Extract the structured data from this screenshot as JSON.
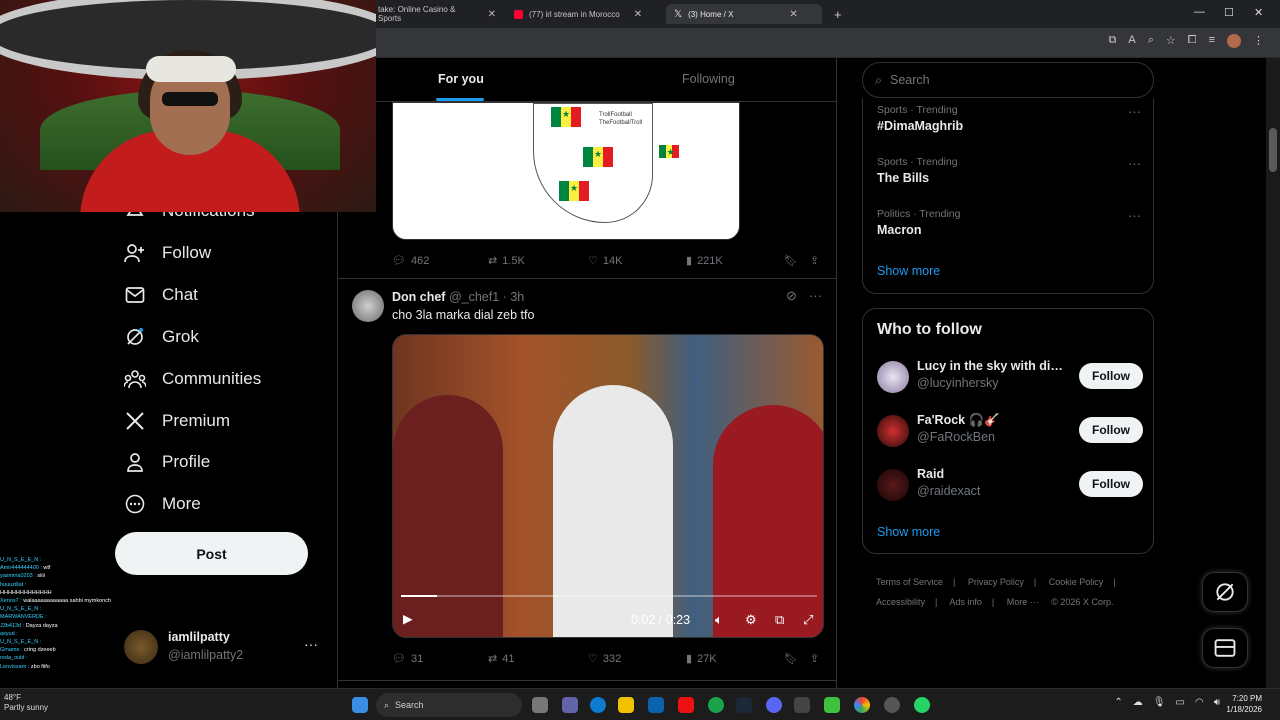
{
  "browser": {
    "tabs": [
      {
        "label": "take: Online Casino & Sports"
      },
      {
        "label": "(77) irl stream in Morocco"
      },
      {
        "label": "(3) Home / X"
      }
    ],
    "new_tab_label": "+"
  },
  "chat_overlay": {
    "messages": [
      {
        "user": "U_N_S_E_E_N :",
        "text": ""
      },
      {
        "user": "Amir444444400 :",
        "text": "wtf"
      },
      {
        "user": "yasmina0203 :",
        "text": "siiii"
      },
      {
        "user": "huuuzillat :",
        "text": ""
      },
      {
        "user": "",
        "text": "HHHHHHHHHHHHH"
      },
      {
        "user": "Xenos7 :",
        "text": "walaaaaaaaaaaaa sahbi mymkonch"
      },
      {
        "user": "U_N_S_E_E_N :",
        "text": ""
      },
      {
        "user": "MARWANVERDE :",
        "text": ""
      },
      {
        "user": "J3b413d :",
        "text": "Dayza dayza"
      },
      {
        "user": "asyud :",
        "text": ""
      },
      {
        "user": "U_N_S_E_E_N :",
        "text": ""
      },
      {
        "user": "Gmame :",
        "text": "cring dzeeeb"
      },
      {
        "user": "reda_ould :",
        "text": ""
      },
      {
        "user": "Lenvissam :",
        "text": "zbo fiifo"
      }
    ]
  },
  "sidebar": {
    "items": [
      {
        "label": "Notifications",
        "icon": "bell-icon"
      },
      {
        "label": "Follow",
        "icon": "person-plus-icon"
      },
      {
        "label": "Chat",
        "icon": "mail-icon"
      },
      {
        "label": "Grok",
        "icon": "grok-icon"
      },
      {
        "label": "Communities",
        "icon": "people-icon"
      },
      {
        "label": "Premium",
        "icon": "x-logo-icon"
      },
      {
        "label": "Profile",
        "icon": "person-icon"
      },
      {
        "label": "More",
        "icon": "more-circle-icon"
      }
    ],
    "post_label": "Post",
    "account": {
      "name": "iamlilpatty",
      "handle": "@iamlilpatty2",
      "menu": "···"
    }
  },
  "timeline": {
    "tabs": {
      "for_you": "For you",
      "following": "Following"
    },
    "first_post": {
      "image_watermark": [
        "TrollFootball",
        "TheFootballTroll"
      ],
      "stats": {
        "replies": "462",
        "reposts": "1.5K",
        "likes": "14K",
        "views": "221K"
      }
    },
    "second_post": {
      "author": "Don chef",
      "handle": "@_chef1",
      "time": "· 3h",
      "text": "cho 3la marka dial zeb tfo",
      "video": {
        "time": "0:02 / 0:23",
        "progress": 0.087
      },
      "stats": {
        "replies": "31",
        "reposts": "41",
        "likes": "332",
        "views": "27K"
      }
    }
  },
  "right_column": {
    "search_placeholder": "Search",
    "trends": [
      {
        "meta": "Sports · Trending",
        "title": "#DimaMaghrib"
      },
      {
        "meta": "Sports · Trending",
        "title": "The Bills"
      },
      {
        "meta": "Politics · Trending",
        "title": "Macron"
      }
    ],
    "trends_show_more": "Show more",
    "who_to_follow": {
      "title": "Who to follow",
      "suggestions": [
        {
          "name": "Lucy in the sky with dia...",
          "handle": "@lucyinhersky",
          "button": "Follow"
        },
        {
          "name": "Fa'Rock 🎧🎸",
          "handle": "@FaRockBen",
          "button": "Follow"
        },
        {
          "name": "Raid",
          "handle": "@raidexact",
          "button": "Follow"
        }
      ],
      "show_more": "Show more"
    },
    "footer": [
      "Terms of Service",
      "|",
      "Privacy Policy",
      "|",
      "Cookie Policy",
      "|",
      "Accessibility",
      "|",
      "Ads info",
      "|",
      "More ···",
      "© 2026 X Corp."
    ]
  },
  "taskbar": {
    "search_label": "Search",
    "weather": {
      "temp": "48°F",
      "desc": "Partly sunny"
    },
    "clock": {
      "time": "7:20 PM",
      "date": "1/18/2026"
    }
  },
  "colors": {
    "accent": "#1d9bf0",
    "background": "#000000",
    "border": "#2f3336"
  }
}
